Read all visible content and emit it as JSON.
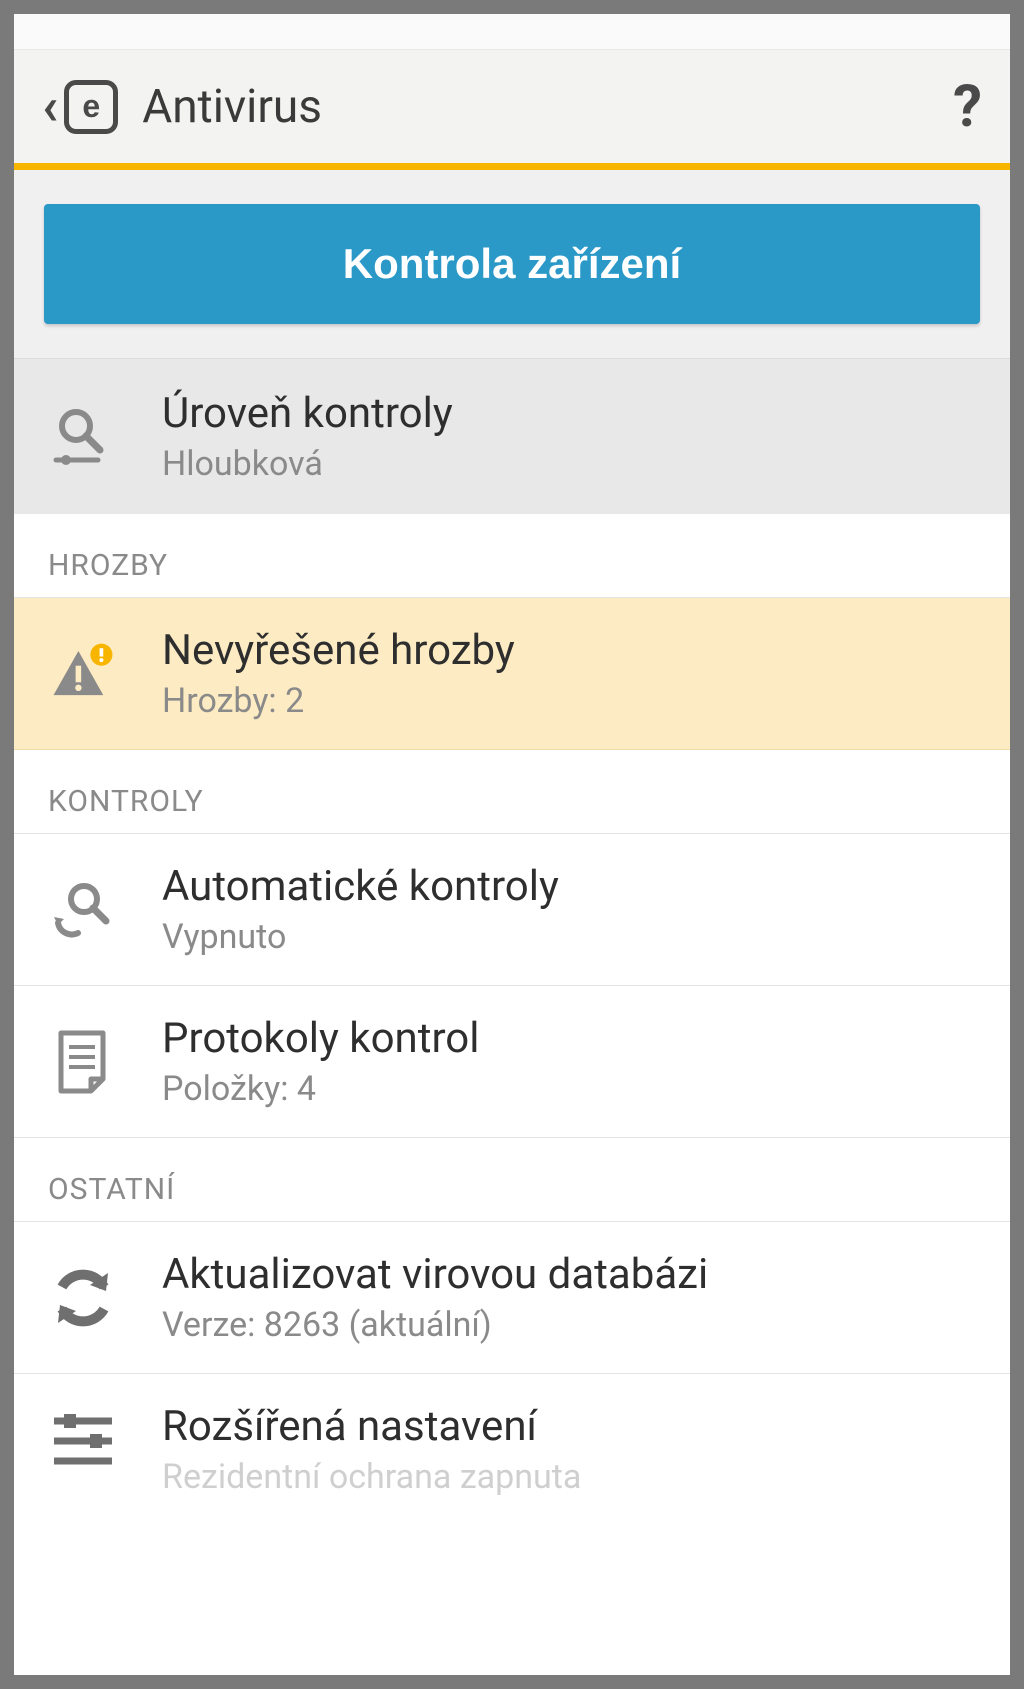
{
  "header": {
    "title": "Antivirus",
    "help": "?"
  },
  "scan": {
    "button_label": "Kontrola zařízení"
  },
  "scan_level": {
    "title": "Úroveň kontroly",
    "subtitle": "Hloubková"
  },
  "sections": {
    "threats_header": "HROZBY",
    "checks_header": "KONTROLY",
    "other_header": "OSTATNÍ"
  },
  "threats": {
    "title": "Nevyřešené hrozby",
    "subtitle": "Hrozby: 2"
  },
  "auto_check": {
    "title": "Automatické kontroly",
    "subtitle": "Vypnuto"
  },
  "logs": {
    "title": "Protokoly kontrol",
    "subtitle": "Položky: 4"
  },
  "update_db": {
    "title": "Aktualizovat virovou databázi",
    "subtitle": "Verze: 8263 (aktuální)"
  },
  "advanced": {
    "title": "Rozšířená nastavení",
    "subtitle": "Rezidentní ochrana zapnuta"
  }
}
